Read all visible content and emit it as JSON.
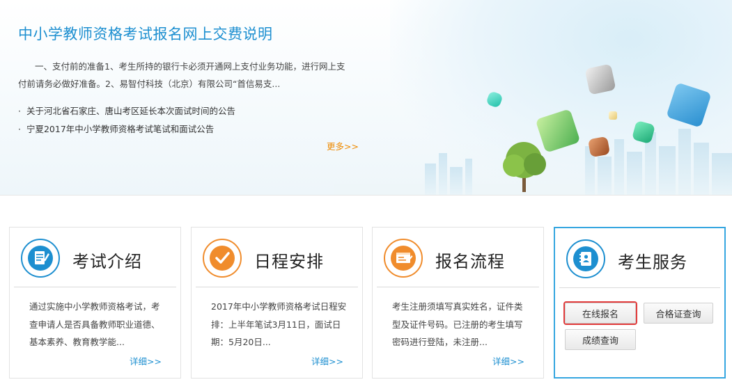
{
  "banner": {
    "title": "中小学教师资格考试报名网上交费说明",
    "description": "一、支付前的准备1、考生所持的银行卡必须开通网上支付业务功能，进行网上支付前请务必做好准备。2、易智付科技（北京）有限公司“首信易支...",
    "news": [
      {
        "bullet": "·",
        "text": "关于河北省石家庄、唐山考区延长本次面试时间的公告"
      },
      {
        "bullet": "·",
        "text": "宁夏2017年中小学教师资格考试笔试和面试公告"
      }
    ],
    "more_label": "更多>>"
  },
  "cards": [
    {
      "title": "考试介绍",
      "icon": "exam-document-icon",
      "text": "通过实施中小学教师资格考试，考查申请人是否具备教师职业道德、基本素养、教育教学能...",
      "detail_label": "详细>>"
    },
    {
      "title": "日程安排",
      "icon": "checkmark-icon",
      "text": "2017年中小学教师资格考试日程安排：上半年笔试3月11日，面试日期：5月20日...",
      "detail_label": "详细>>"
    },
    {
      "title": "报名流程",
      "icon": "form-icon",
      "text": "考生注册须填写真实姓名，证件类型及证件号码。已注册的考生填写密码进行登陆，未注册...",
      "detail_label": "详细>>"
    },
    {
      "title": "考生服务",
      "icon": "contact-book-icon",
      "buttons": {
        "online_register": "在线报名",
        "certificate_query": "合格证查询",
        "score_query": "成绩查询"
      }
    }
  ],
  "colors": {
    "accent_blue": "#1d8fd0",
    "accent_orange": "#f08c2c",
    "more_orange": "#ee8a00",
    "highlight_red": "#e23b3b"
  }
}
